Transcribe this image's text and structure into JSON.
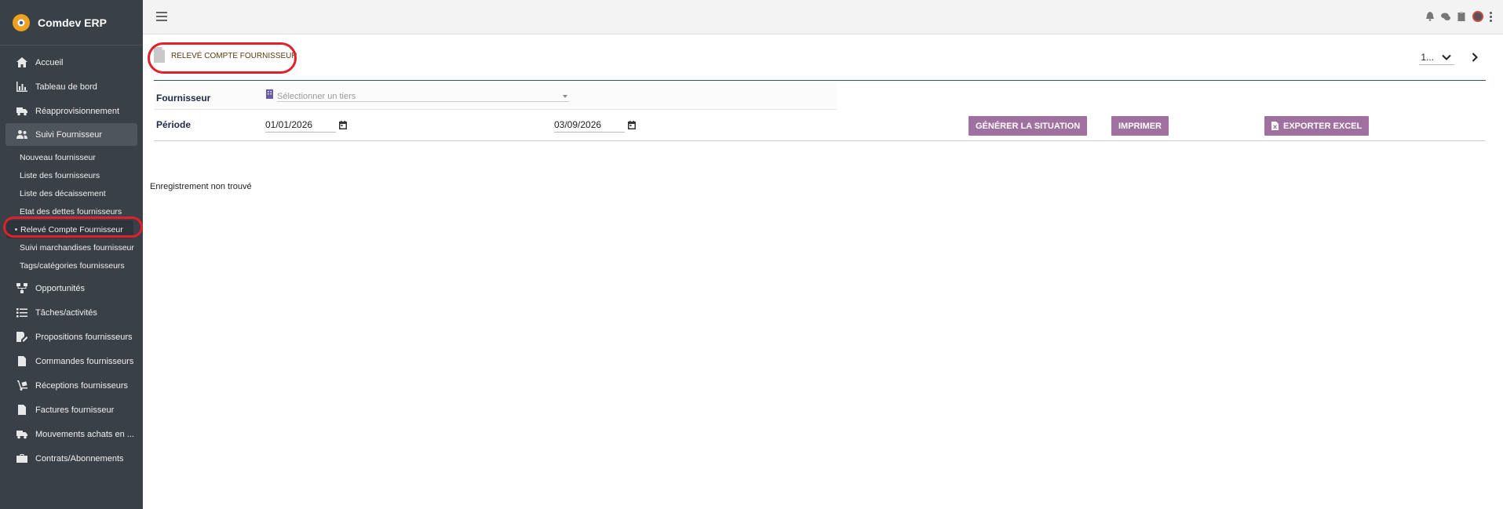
{
  "brand": {
    "name": "Comdev ERP"
  },
  "sidebar": {
    "items": [
      {
        "label": "Accueil",
        "icon": "home-icon"
      },
      {
        "label": "Tableau de bord",
        "icon": "chart-icon"
      },
      {
        "label": "Réapprovisionnement",
        "icon": "truck-icon"
      },
      {
        "label": "Suivi Fournisseur",
        "icon": "users-icon"
      },
      {
        "label": "Opportunités",
        "icon": "network-icon"
      },
      {
        "label": "Tâches/activités",
        "icon": "tasks-icon"
      },
      {
        "label": "Propositions fournisseurs",
        "icon": "edit-doc-icon"
      },
      {
        "label": "Commandes fournisseurs",
        "icon": "doc-icon"
      },
      {
        "label": "Réceptions fournisseurs",
        "icon": "dolly-icon"
      },
      {
        "label": "Factures fournisseur",
        "icon": "invoice-icon"
      },
      {
        "label": "Mouvements achats en ...",
        "icon": "truck-icon"
      },
      {
        "label": "Contrats/Abonnements",
        "icon": "briefcase-icon"
      }
    ],
    "sub_items": [
      "Nouveau fournisseur",
      "Liste des fournisseurs",
      "Liste des décaissement",
      "Etat des dettes fournisseurs",
      "Relevé Compte Fournisseur",
      "Suivi marchandises fournisseur",
      "Tags/catégories fournisseurs"
    ]
  },
  "page": {
    "title": "RELEVÉ COMPTE FOURNISSEUR",
    "pager_value": "1..."
  },
  "form": {
    "fournisseur_label": "Fournisseur",
    "tiers_placeholder": "Sélectionner un tiers",
    "periode_label": "Période",
    "date_from": "01/01/2026",
    "date_to": "03/09/2026"
  },
  "buttons": {
    "generate": "GÉNÉRER LA SITUATION",
    "print": "IMPRIMER",
    "export": "EXPORTER EXCEL"
  },
  "empty_message": "Enregistrement non trouvé",
  "colors": {
    "sidebar": "#3a4048",
    "button": "#a070a0",
    "highlight": "#e0202a"
  }
}
